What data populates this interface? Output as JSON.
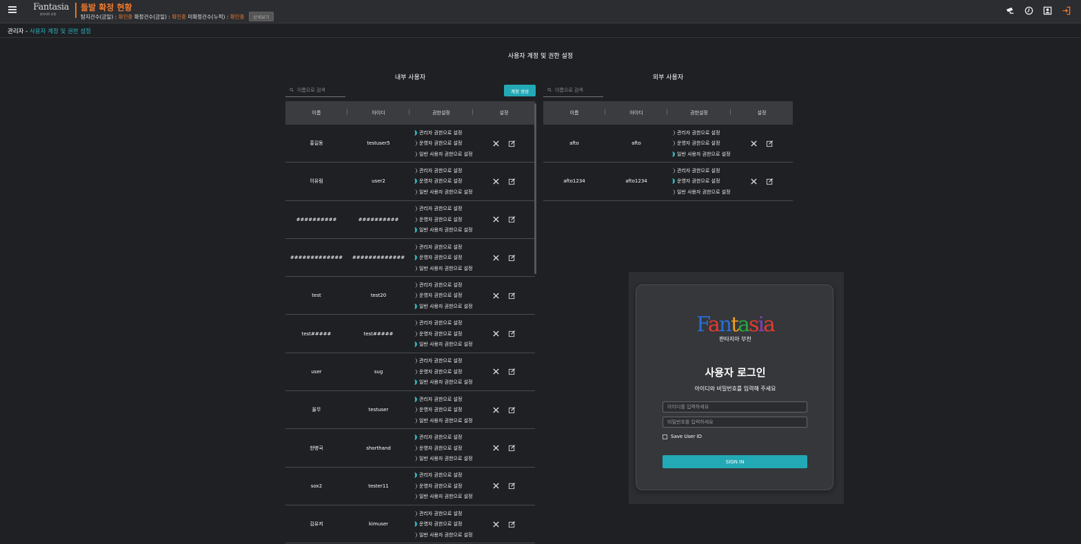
{
  "header": {
    "alert_title": "돌발 확정 현황",
    "stats": [
      {
        "label": "탐지건수(금일) :",
        "value": "확인중"
      },
      {
        "label": "확정건수(금일) :",
        "value": "확인중"
      },
      {
        "label": "미확정건수(누적) :",
        "value": "확인중"
      }
    ],
    "detail_button": "상세보기",
    "logo_word": "Fantasia",
    "logo_sub": "판타지아 부천"
  },
  "breadcrumb": {
    "root": "관리자",
    "separator": " - ",
    "current": "사용자 계정 및 권한 설정"
  },
  "page_title": "사용자 계정 및 권한 설정",
  "permission_labels": [
    "관리자 권한으로 설정",
    "운영자 권한으로 설정",
    "일반 사용자 권한으로 설정"
  ],
  "internal": {
    "title": "내부 사용자",
    "search_placeholder": "이름으로 검색",
    "create_button": "계정 생성",
    "columns": [
      "이름",
      "아이디",
      "권한설정",
      "설정"
    ],
    "rows": [
      {
        "name": "홍길동",
        "id": "testuser5",
        "role": 0
      },
      {
        "name": "이유림",
        "id": "user2",
        "role": 1
      },
      {
        "name": "##########",
        "id": "##########",
        "role": 2
      },
      {
        "name": "#############",
        "id": "#############",
        "role": 1
      },
      {
        "name": "test",
        "id": "test20",
        "role": 2
      },
      {
        "name": "test#####",
        "id": "test#####",
        "role": 2
      },
      {
        "name": "user",
        "id": "sug",
        "role": 2
      },
      {
        "name": "올무",
        "id": "testuser",
        "role": 0
      },
      {
        "name": "한병국",
        "id": "shorthand",
        "role": 0
      },
      {
        "name": "sox2",
        "id": "tester11",
        "role": 0
      },
      {
        "name": "김유저",
        "id": "kimuser",
        "role": 1
      }
    ]
  },
  "external": {
    "title": "외부 사용자",
    "search_placeholder": "이름으로 검색",
    "columns": [
      "이름",
      "아이디",
      "권한설정",
      "설정"
    ],
    "rows": [
      {
        "name": "afto",
        "id": "afto",
        "role": 2
      },
      {
        "name": "afto1234",
        "id": "afto1234",
        "role": 1
      }
    ]
  },
  "login": {
    "logo_word": "Fantasia",
    "logo_sub": "판타지아 부천",
    "title": "사용자 로그인",
    "subtitle": "아이디와 비밀번호를 입력해 주세요",
    "id_placeholder": "아이디를 입력하세요",
    "pw_placeholder": "비밀번호를 입력하세요",
    "save_label": "Save User ID",
    "signin_label": "SIGN IN"
  },
  "colors": {
    "accent": "#23a9b5",
    "alert": "#f07a2e",
    "background": "#1e2023"
  }
}
